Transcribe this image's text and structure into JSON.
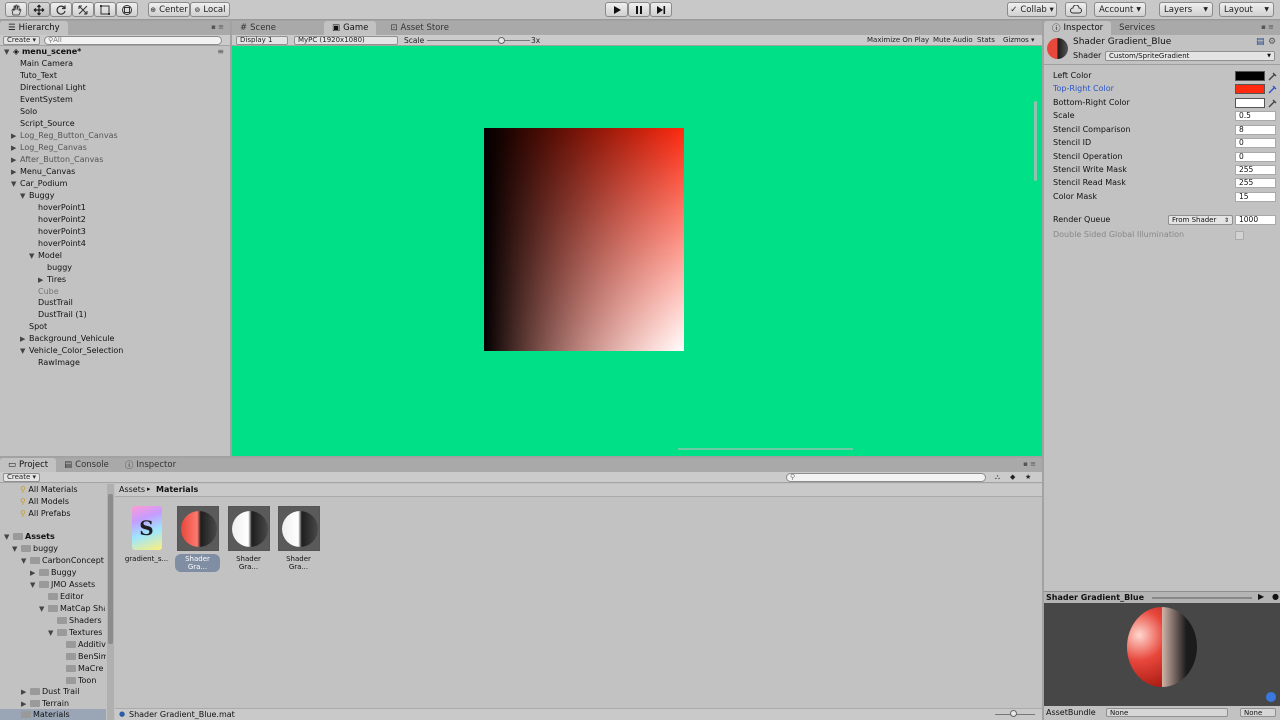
{
  "toolbar": {
    "pivot_label": "Center",
    "space_label": "Local",
    "collab_label": "Collab ▾",
    "account_label": "Account",
    "layers_label": "Layers",
    "layout_label": "Layout"
  },
  "hierarchy": {
    "tab_label": "Hierarchy",
    "create_label": "Create ▾",
    "search_placeholder": "All",
    "scene_name": "menu_scene*",
    "items": [
      {
        "label": "Main Camera"
      },
      {
        "label": "Tuto_Text"
      },
      {
        "label": "Directional Light"
      },
      {
        "label": "EventSystem"
      },
      {
        "label": "Solo"
      },
      {
        "label": "Script_Source"
      },
      {
        "label": "Log_Reg_Button_Canvas"
      },
      {
        "label": "Log_Reg_Canvas"
      },
      {
        "label": "After_Button_Canvas"
      },
      {
        "label": "Menu_Canvas"
      },
      {
        "label": "Car_Podium"
      },
      {
        "label": "Buggy"
      },
      {
        "label": "hoverPoint1"
      },
      {
        "label": "hoverPoint2"
      },
      {
        "label": "hoverPoint3"
      },
      {
        "label": "hoverPoint4"
      },
      {
        "label": "Model"
      },
      {
        "label": "buggy"
      },
      {
        "label": "Tires"
      },
      {
        "label": "Cube"
      },
      {
        "label": "DustTrail"
      },
      {
        "label": "DustTrail (1)"
      },
      {
        "label": "Spot"
      },
      {
        "label": "Background_Vehicule"
      },
      {
        "label": "Vehicle_Color_Selection"
      },
      {
        "label": "RawImage"
      }
    ]
  },
  "viewtabs": {
    "scene": "Scene",
    "game": "Game",
    "asset_store": "Asset Store"
  },
  "gamebar": {
    "display": "Display 1",
    "resolution": "MyPC (1920x1080)",
    "scale_label": "Scale",
    "scale_value": "3x",
    "maximize": "Maximize On Play",
    "mute": "Mute Audio",
    "stats": "Stats",
    "gizmos": "Gizmos ▾"
  },
  "colors": {
    "game_bg": "#00e187",
    "top_right": "#ff2a10"
  },
  "inspector": {
    "tab_label": "Inspector",
    "services_label": "Services",
    "material_name": "Shader Gradient_Blue",
    "shader_label": "Shader",
    "shader_value": "Custom/SpriteGradient",
    "props": {
      "left_color": "Left Color",
      "top_right_color": "Top-Right Color",
      "bottom_right_color": "Bottom-Right Color",
      "scale": "Scale",
      "stencil_comparison": "Stencil Comparison",
      "stencil_id": "Stencil ID",
      "stencil_operation": "Stencil Operation",
      "stencil_write_mask": "Stencil Write Mask",
      "stencil_read_mask": "Stencil Read Mask",
      "color_mask": "Color Mask"
    },
    "values": {
      "scale": "0.5",
      "stencil_comparison": "8",
      "stencil_id": "0",
      "stencil_operation": "0",
      "stencil_write_mask": "255",
      "stencil_read_mask": "255",
      "color_mask": "15"
    },
    "render_queue_label": "Render Queue",
    "render_queue_mode": "From Shader",
    "render_queue_value": "1000",
    "double_sided_label": "Double Sided Global Illumination",
    "preview_title": "Shader Gradient_Blue",
    "assetbundle_label": "AssetBundle",
    "assetbundle_value": "None",
    "assetbundle_variant": "None"
  },
  "project": {
    "tabs": {
      "project": "Project",
      "console": "Console",
      "inspector": "Inspector"
    },
    "create_label": "Create ▾",
    "favorites": [
      "All Materials",
      "All Models",
      "All Prefabs"
    ],
    "assets_root": "Assets",
    "folders": [
      {
        "label": "buggy"
      },
      {
        "label": "CarbonConcept"
      },
      {
        "label": "Buggy"
      },
      {
        "label": "JMO Assets"
      },
      {
        "label": "Editor"
      },
      {
        "label": "MatCap Sha"
      },
      {
        "label": "Shaders"
      },
      {
        "label": "Textures"
      },
      {
        "label": "Additiv"
      },
      {
        "label": "BenSim"
      },
      {
        "label": "MaCre"
      },
      {
        "label": "Toon"
      },
      {
        "label": "Dust Trail"
      },
      {
        "label": "Terrain"
      },
      {
        "label": "Materials"
      }
    ],
    "breadcrumb": {
      "root": "Assets",
      "current": "Materials"
    },
    "assets": [
      {
        "label": "gradient_s..."
      },
      {
        "label": "Shader Gra..."
      },
      {
        "label": "Shader Gra..."
      },
      {
        "label": "Shader Gra..."
      }
    ],
    "selected_file": "Shader Gradient_Blue.mat"
  }
}
